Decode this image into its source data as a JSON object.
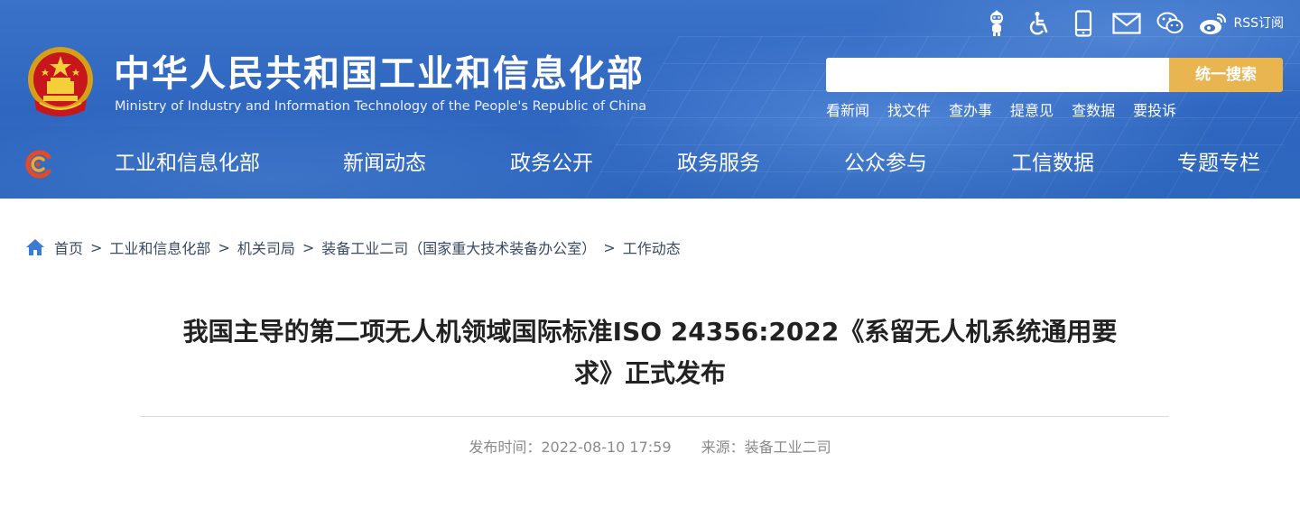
{
  "header": {
    "site_title": "中华人民共和国工业和信息化部",
    "site_subtitle": "Ministry of Industry and Information Technology of the People's Republic of China",
    "top_icons": [
      "robot-assistant-icon",
      "accessibility-icon",
      "mobile-icon",
      "mail-icon",
      "wechat-icon",
      "weibo-icon",
      "rss-icon"
    ],
    "rss_label": "RSS订阅",
    "search": {
      "value": "",
      "placeholder": "",
      "button_label": "统一搜索"
    },
    "quick_links": [
      "看新闻",
      "找文件",
      "查办事",
      "提意见",
      "查数据",
      "要投诉"
    ],
    "nav": [
      "工业和信息化部",
      "新闻动态",
      "政务公开",
      "政务服务",
      "公众参与",
      "工信数据",
      "专题专栏"
    ]
  },
  "breadcrumb": [
    "首页",
    "工业和信息化部",
    "机关司局",
    "装备工业二司（国家重大技术装备办公室）",
    "工作动态"
  ],
  "breadcrumb_sep": ">",
  "article": {
    "title_line1": "我国主导的第二项无人机领域国际标准ISO 24356:2022《系留无人机系统通用要",
    "title_line2": "求》正式发布",
    "publish_label": "发布时间：2022-08-10 17:59",
    "source_label": "来源：装备工业二司"
  },
  "colors": {
    "header_blue": "#3a72c8",
    "search_button": "#e8b550",
    "breadcrumb_icon": "#3a7bd5"
  }
}
